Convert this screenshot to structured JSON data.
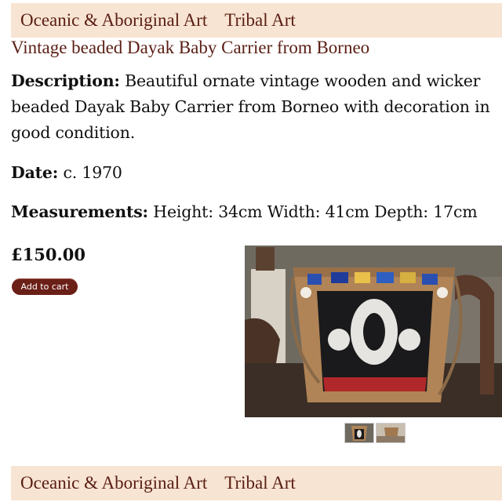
{
  "nav": {
    "items": [
      {
        "label": "Oceanic & Aboriginal Art"
      },
      {
        "label": "Tribal Art"
      }
    ]
  },
  "product": {
    "title": "Vintage beaded Dayak Baby Carrier from Borneo",
    "description_label": "Description:",
    "description": "Beautiful ornate vintage wooden and wicker beaded Dayak Baby Carrier from Borneo with decoration in good condition.",
    "date_label": "Date:",
    "date": "c. 1970",
    "measurements_label": "Measurements:",
    "measurements": "Height: 34cm Width: 41cm Depth: 17cm",
    "price": "£150.00",
    "add_to_cart_label": "Add to cart"
  },
  "colors": {
    "nav_background": "#f8e4d2",
    "link": "#5a1e14",
    "button": "#6a1f17"
  }
}
